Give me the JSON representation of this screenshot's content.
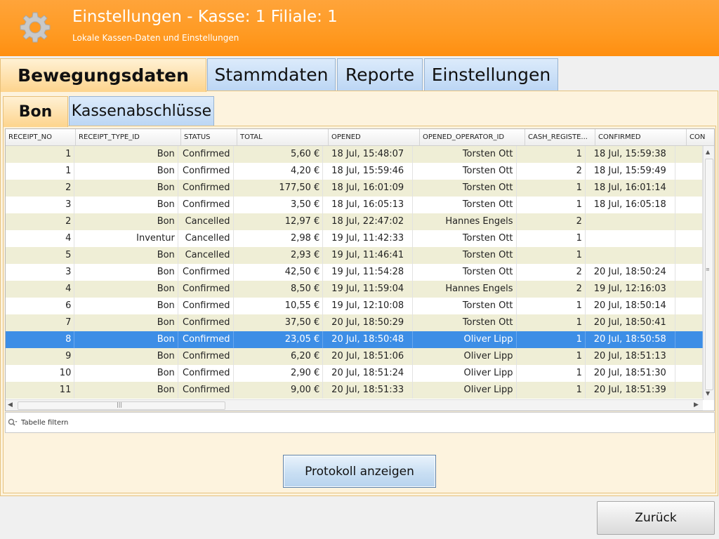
{
  "header": {
    "title": "Einstellungen - Kasse: 1 Filiale: 1",
    "subtitle": "Lokale Kassen-Daten und Einstellungen"
  },
  "main_tabs": [
    {
      "label": "Bewegungsdaten",
      "active": true
    },
    {
      "label": "Stammdaten",
      "active": false
    },
    {
      "label": "Reporte",
      "active": false
    },
    {
      "label": "Einstellungen",
      "active": false
    }
  ],
  "sub_tabs": [
    {
      "label": "Bon",
      "active": true
    },
    {
      "label": "Kassenabschlüsse",
      "active": false
    }
  ],
  "table": {
    "columns": [
      "RECEIPT_NO",
      "RECEIPT_TYPE_ID",
      "STATUS",
      "TOTAL",
      "OPENED",
      "OPENED_OPERATOR_ID",
      "CASH_REGISTE...",
      "CONFIRMED",
      "CON"
    ],
    "rows": [
      [
        "1",
        "Bon",
        "Confirmed",
        "5,60 €",
        "18 Jul, 15:48:07",
        "Torsten Ott",
        "1",
        "18 Jul, 15:59:38"
      ],
      [
        "1",
        "Bon",
        "Confirmed",
        "4,20 €",
        "18 Jul, 15:59:46",
        "Torsten Ott",
        "2",
        "18 Jul, 15:59:49"
      ],
      [
        "2",
        "Bon",
        "Confirmed",
        "177,50 €",
        "18 Jul, 16:01:09",
        "Torsten Ott",
        "1",
        "18 Jul, 16:01:14"
      ],
      [
        "3",
        "Bon",
        "Confirmed",
        "3,50 €",
        "18 Jul, 16:05:13",
        "Torsten Ott",
        "1",
        "18 Jul, 16:05:18"
      ],
      [
        "2",
        "Bon",
        "Cancelled",
        "12,97 €",
        "18 Jul, 22:47:02",
        "Hannes Engels",
        "2",
        ""
      ],
      [
        "4",
        "Inventur",
        "Cancelled",
        "2,98 €",
        "19 Jul, 11:42:33",
        "Torsten Ott",
        "1",
        ""
      ],
      [
        "5",
        "Bon",
        "Cancelled",
        "2,93 €",
        "19 Jul, 11:46:41",
        "Torsten Ott",
        "1",
        ""
      ],
      [
        "3",
        "Bon",
        "Confirmed",
        "42,50 €",
        "19 Jul, 11:54:28",
        "Torsten Ott",
        "2",
        "20 Jul, 18:50:24"
      ],
      [
        "4",
        "Bon",
        "Confirmed",
        "8,50 €",
        "19 Jul, 11:59:04",
        "Hannes Engels",
        "2",
        "19 Jul, 12:16:03"
      ],
      [
        "6",
        "Bon",
        "Confirmed",
        "10,55 €",
        "19 Jul, 12:10:08",
        "Torsten Ott",
        "1",
        "20 Jul, 18:50:14"
      ],
      [
        "7",
        "Bon",
        "Confirmed",
        "37,50 €",
        "20 Jul, 18:50:29",
        "Torsten Ott",
        "1",
        "20 Jul, 18:50:41"
      ],
      [
        "8",
        "Bon",
        "Confirmed",
        "23,05 €",
        "20 Jul, 18:50:48",
        "Oliver Lipp",
        "1",
        "20 Jul, 18:50:58"
      ],
      [
        "9",
        "Bon",
        "Confirmed",
        "6,20 €",
        "20 Jul, 18:51:06",
        "Oliver Lipp",
        "1",
        "20 Jul, 18:51:13"
      ],
      [
        "10",
        "Bon",
        "Confirmed",
        "2,90 €",
        "20 Jul, 18:51:24",
        "Oliver Lipp",
        "1",
        "20 Jul, 18:51:30"
      ],
      [
        "11",
        "Bon",
        "Confirmed",
        "9,00 €",
        "20 Jul, 18:51:33",
        "Oliver Lipp",
        "1",
        "20 Jul, 18:51:39"
      ]
    ],
    "selected_row": 11
  },
  "filter": {
    "placeholder": "Tabelle filtern"
  },
  "buttons": {
    "protokoll": "Protokoll anzeigen",
    "back": "Zurück"
  },
  "colors": {
    "header_orange": "#ff9a22",
    "selection_blue": "#3d8ee6",
    "row_alt": "#efeed6"
  },
  "icons": {
    "header": "gear-icon",
    "filter": "search-icon"
  }
}
